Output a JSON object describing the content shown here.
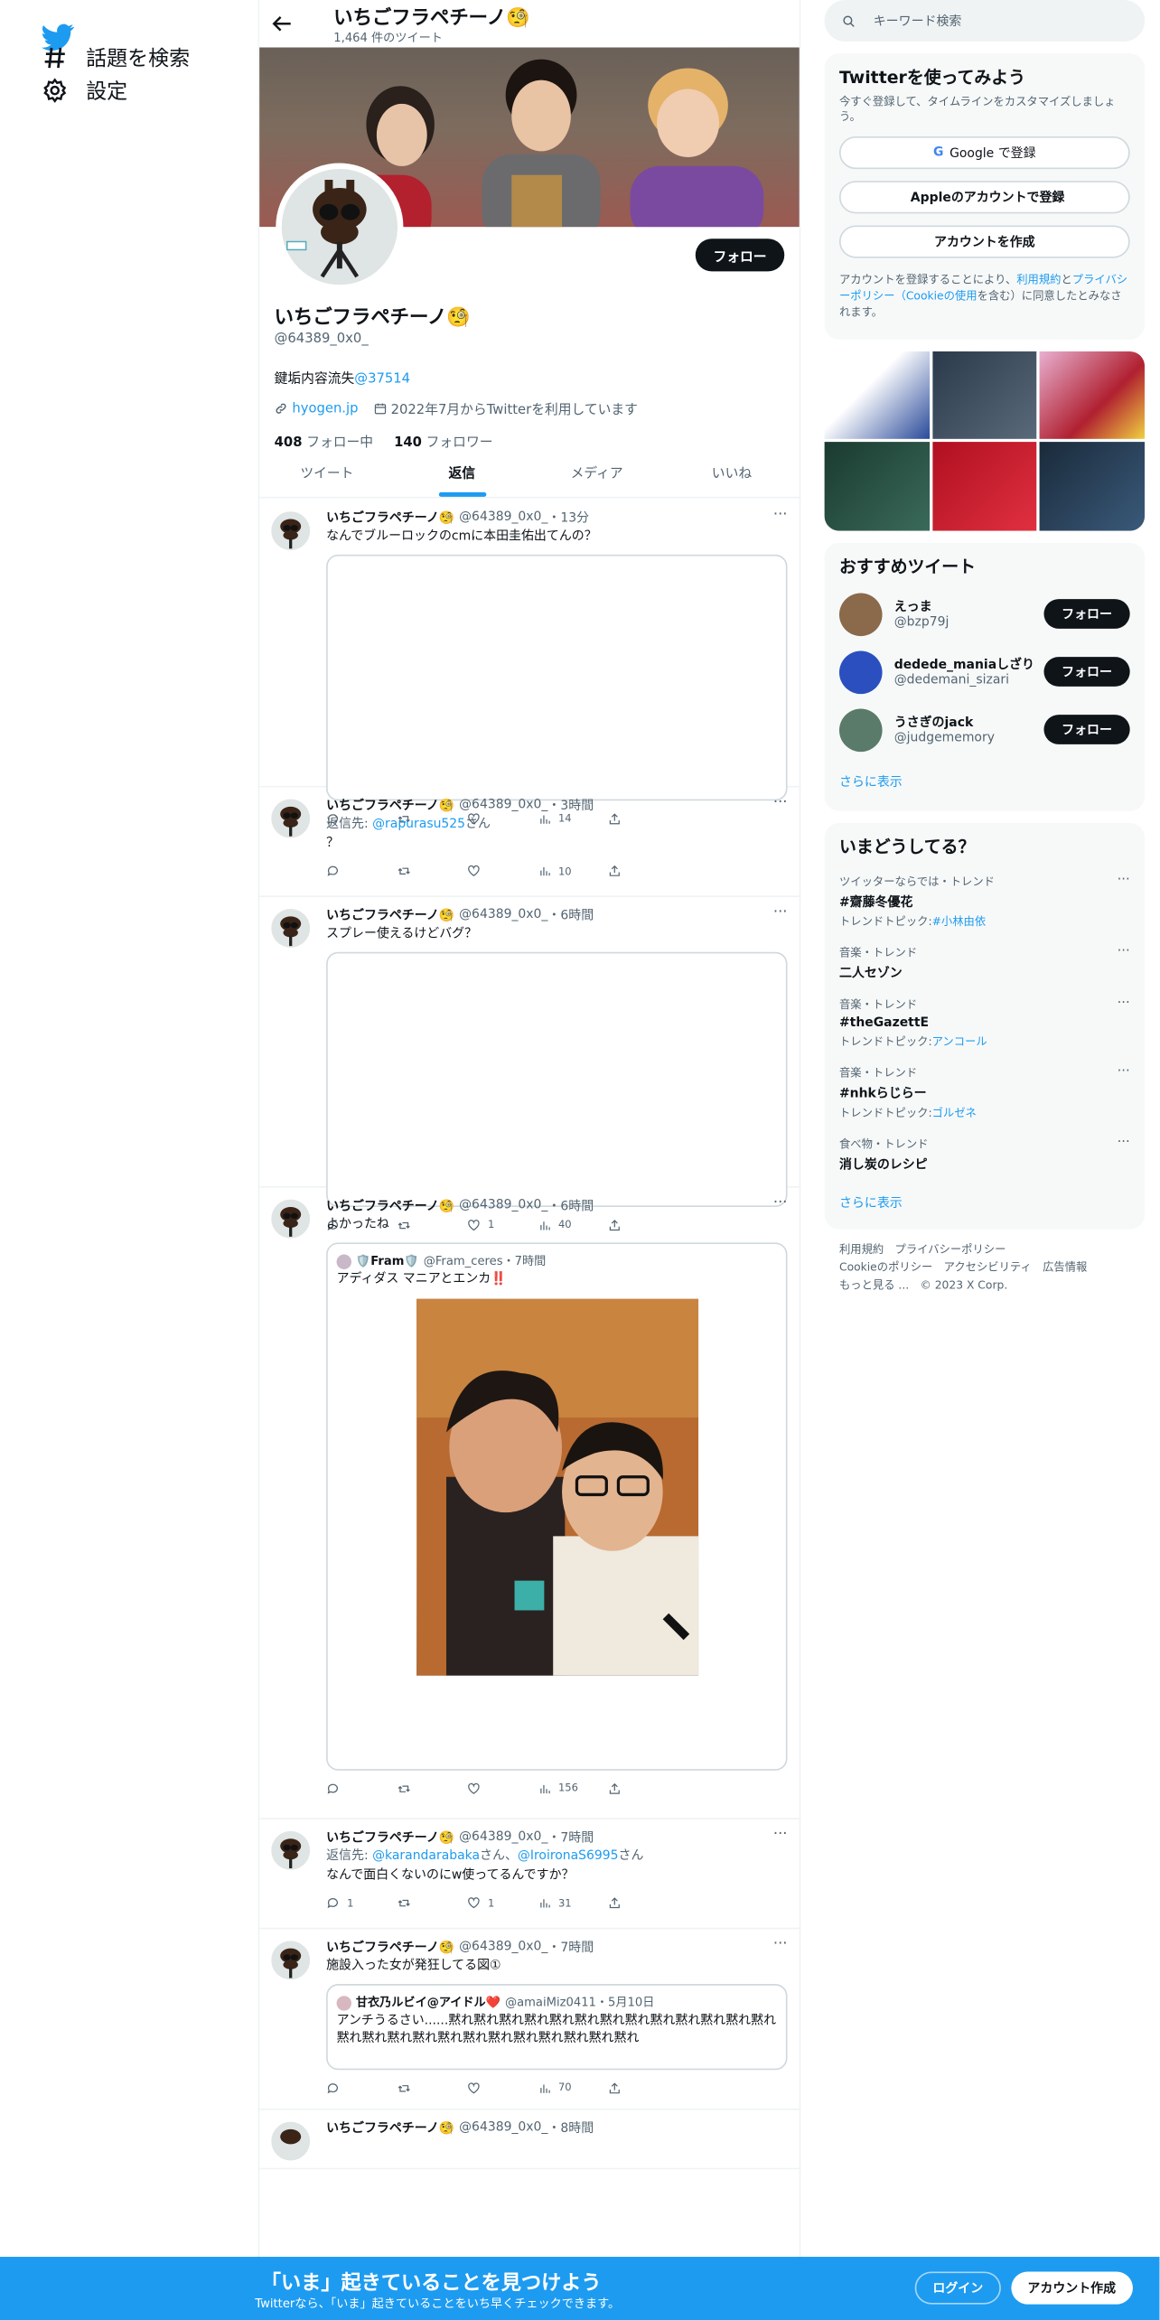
{
  "nav": {
    "explore": "話題を検索",
    "settings": "設定"
  },
  "header": {
    "name": "いちごフラペチーノ🧐",
    "tweet_count": "1,464 件のツイート"
  },
  "profile": {
    "follow_label": "フォロー",
    "name": "いちごフラペチーノ🧐",
    "handle": "@64389_0x0_",
    "bio": "鍵垢内容流失",
    "bio_link": "@37514",
    "website": "hyogen.jp",
    "joined": "2022年7月からTwitterを利用しています",
    "following_count": "408",
    "following_label": "フォロー中",
    "followers_count": "140",
    "followers_label": "フォロワー"
  },
  "tabs": [
    "ツイート",
    "返信",
    "メディア",
    "いいね"
  ],
  "tweets": [
    {
      "name": "いちごフラペチーノ🧐",
      "handle": "@64389_0x0_",
      "time": "・13分",
      "text": "なんでブルーロックのcmに本田圭佑出てんの？",
      "reply": "",
      "likes": "",
      "replies": "",
      "views": "14"
    },
    {
      "name": "いちごフラペチーノ🧐",
      "handle": "@64389_0x0_",
      "time": "・3時間",
      "reply_prefix": "返信先:",
      "reply_to": "@rapurasu525",
      "reply_suffix": "さん",
      "text": "？",
      "views": "10"
    },
    {
      "name": "いちごフラペチーノ🧐",
      "handle": "@64389_0x0_",
      "time": "・6時間",
      "text": "スプレー使えるけどバグ？",
      "likes": "1",
      "views": "40"
    },
    {
      "name": "いちごフラペチーノ🧐",
      "handle": "@64389_0x0_",
      "time": "・6時間",
      "text": "よかったね",
      "views": "156",
      "quote": {
        "name": "🛡️Fram🛡️",
        "handle": "@Fram_ceres",
        "time": "・7時間",
        "text": "アディダス マニアとエンカ‼️"
      }
    },
    {
      "name": "いちごフラペチーノ🧐",
      "handle": "@64389_0x0_",
      "time": "・7時間",
      "reply_prefix": "返信先:",
      "reply_to": "@karandarabaka",
      "reply_mid": "さん、",
      "reply_to2": "@IroironaS6995",
      "reply_suffix": "さん",
      "text": "なんで面白くないのにw使ってるんですか？",
      "replies": "1",
      "likes": "1",
      "views": "31"
    },
    {
      "name": "いちごフラペチーノ🧐",
      "handle": "@64389_0x0_",
      "time": "・7時間",
      "text": "施設入った女が発狂してる図①",
      "views": "70",
      "quote": {
        "name": "甘衣乃ルビイ@アイドル❤️",
        "handle": "@amaiMiz0411",
        "time": "・5月10日",
        "text": "アンチうるさい......黙れ黙れ黙れ黙れ黙れ黙れ黙れ黙れ黙れ黙れ黙れ黙れ黙れ黙れ黙れ黙れ黙れ黙れ黙れ黙れ黙れ黙れ黙れ黙れ黙れ"
      }
    },
    {
      "name": "いちごフラペチーノ🧐",
      "handle": "@64389_0x0_",
      "time": "・8時間"
    }
  ],
  "right": {
    "search_placeholder": "キーワード検索",
    "signup_title": "Twitterを使ってみよう",
    "signup_sub": "今すぐ登録して、タイムラインをカスタマイズしましょう。",
    "google_btn": "Google で登録",
    "apple_btn": "Appleのアカウントで登録",
    "create_btn": "アカウントを作成",
    "legal_1": "アカウントを登録することにより、",
    "legal_terms": "利用規約",
    "legal_and": "と",
    "legal_privacy": "プライバシーポリシー",
    "legal_cookie": "（Cookieの使用",
    "legal_2": "を含む）に同意したとみなされます。",
    "rec_title": "おすすめツイート",
    "suggestions": [
      {
        "name": "えっま",
        "handle": "@bzp79j",
        "color": "#8a6a4a"
      },
      {
        "name": "dedede_maniaしざり",
        "handle": "@dedemani_sizari",
        "color": "#2b4fbf"
      },
      {
        "name": "うさぎのjack",
        "handle": "@judgememory",
        "color": "#5a7a6a"
      }
    ],
    "suggest_follow": "フォロー",
    "show_more": "さらに表示",
    "trends_title": "いまどうしてる？",
    "trends": [
      {
        "context": "ツイッターならでは・トレンド",
        "name": "#齋藤冬優花",
        "topic_label": "トレンドトピック:",
        "topic": "#小林由依"
      },
      {
        "context": "音楽・トレンド",
        "name": "二人セゾン",
        "topic_label": "",
        "topic": ""
      },
      {
        "context": "音楽・トレンド",
        "name": "#theGazettE",
        "topic_label": "トレンドトピック:",
        "topic": "アンコール"
      },
      {
        "context": "音楽・トレンド",
        "name": "#nhkらじらー",
        "topic_label": "トレンドトピック:",
        "topic": "ゴルゼネ"
      },
      {
        "context": "食べ物・トレンド",
        "name": "消し炭のレシピ",
        "topic_label": "",
        "topic": ""
      }
    ],
    "footer": [
      "利用規約",
      "プライバシーポリシー",
      "Cookieのポリシー",
      "アクセシビリティ",
      "広告情報",
      "もっと見る ...",
      "© 2023 X Corp."
    ]
  },
  "bottom": {
    "title": "「いま」起きていることを見つけよう",
    "sub": "Twitterなら、「いま」起きていることをいち早くチェックできます。",
    "login": "ログイン",
    "signup": "アカウント作成"
  },
  "colors": {
    "accent": "#1d9bf0",
    "text": "#0f1419",
    "muted": "#536471"
  }
}
